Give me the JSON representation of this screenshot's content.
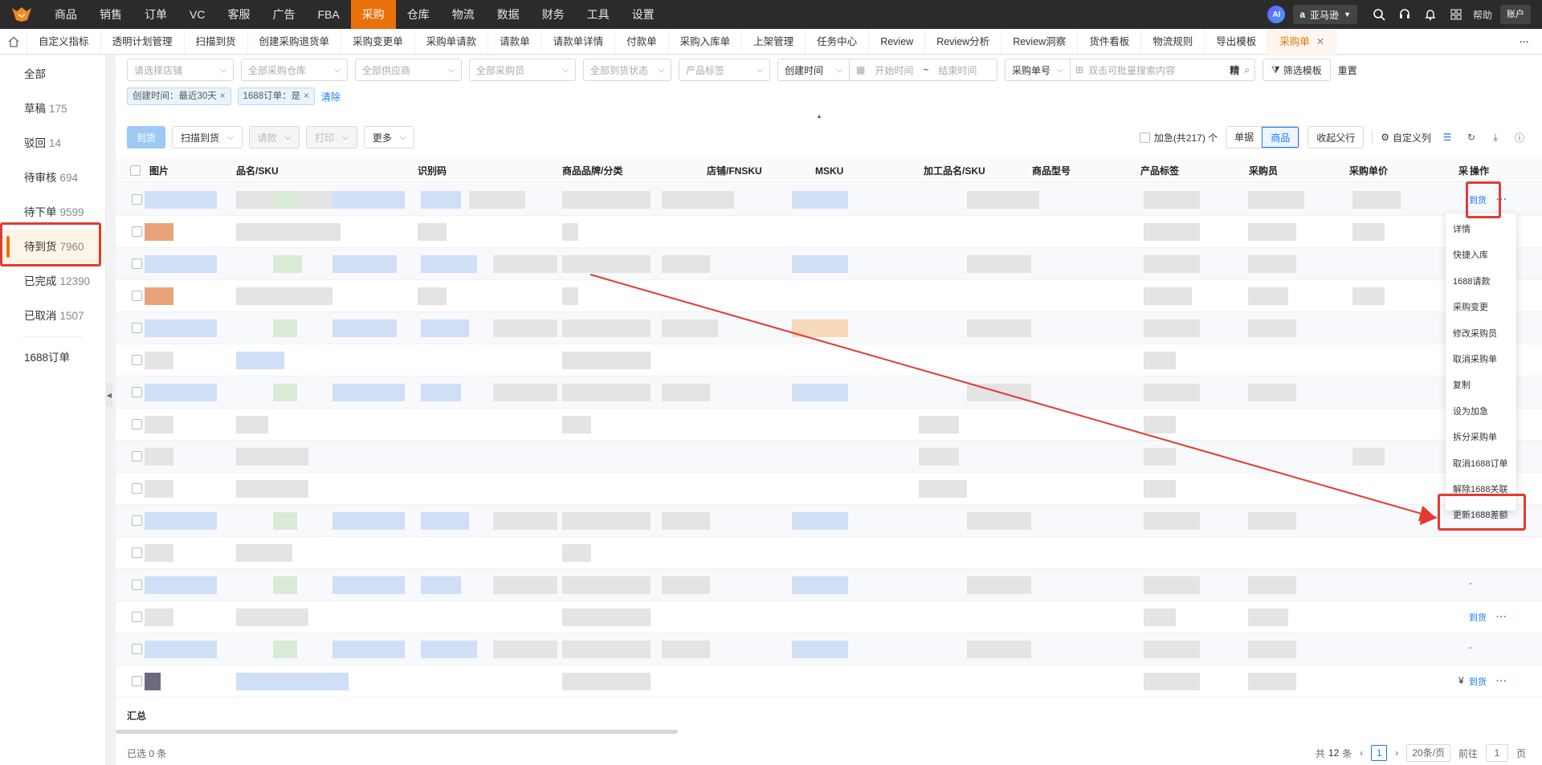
{
  "topnav": {
    "items": [
      "商品",
      "销售",
      "订单",
      "VC",
      "客服",
      "广告",
      "FBA",
      "采购",
      "仓库",
      "物流",
      "数据",
      "财务",
      "工具",
      "设置"
    ],
    "active_index": 7,
    "ai_label": "AI",
    "site": "亚马逊",
    "help": "帮助",
    "account": "账户"
  },
  "tabs": [
    "自定义指标",
    "透明计划管理",
    "扫描到货",
    "创建采购退货单",
    "采购变更单",
    "采购单请款",
    "请款单",
    "请款单详情",
    "付款单",
    "采购入库单",
    "上架管理",
    "任务中心",
    "Review",
    "Review分析",
    "Review洞察",
    "货件看板",
    "物流规则",
    "导出模板",
    "采购单"
  ],
  "tab_more": "···",
  "sidebar": [
    {
      "label": "全部",
      "count": ""
    },
    {
      "label": "草稿",
      "count": "175"
    },
    {
      "label": "驳回",
      "count": "14"
    },
    {
      "label": "待审核",
      "count": "694"
    },
    {
      "label": "待下单",
      "count": "9599"
    },
    {
      "label": "待到货",
      "count": "7960"
    },
    {
      "label": "已完成",
      "count": "12390"
    },
    {
      "label": "已取消",
      "count": "1507"
    },
    {
      "label": "1688订单",
      "count": ""
    }
  ],
  "filters": {
    "shop": "请选择店铺",
    "warehouse": "全部采购仓库",
    "supplier": "全部供应商",
    "buyer": "全部采购员",
    "arrival": "全部到货状态",
    "tag": "产品标签",
    "time_type": "创建时间",
    "start": "开始时间",
    "tilde": "~",
    "end": "结束时间",
    "no_type": "采购单号",
    "search_placeholder": "双击可批量搜索内容",
    "precise": "精",
    "template": "筛选模板",
    "reset": "重置"
  },
  "chips": [
    "创建时间：最近30天",
    "1688订单：是"
  ],
  "clear": "清除",
  "toolbar": {
    "arrive": "到货",
    "scan": "扫描到货",
    "pay_req": "请款",
    "print": "打印",
    "more": "更多",
    "urgent": "加急(共217) 个",
    "view_order": "单据",
    "view_goods": "商品",
    "collapse_parent": "收起父行",
    "custom_cols": "自定义列"
  },
  "columns": [
    "图片",
    "品名/SKU",
    "识别码",
    "商品品牌/分类",
    "店铺/FNSKU",
    "MSKU",
    "加工品名/SKU",
    "商品型号",
    "产品标签",
    "采购员",
    "采购单价",
    "采",
    "操作"
  ],
  "row_ops": [
    {
      "arrive": "到货",
      "more": "···"
    },
    {
      "arrive": "",
      "more": ""
    },
    {
      "arrive": "",
      "more": ""
    },
    {
      "arrive": "",
      "more": ""
    },
    {
      "arrive": "",
      "more": ""
    },
    {
      "arrive": "",
      "more": ""
    },
    {
      "arrive": "",
      "more": ""
    },
    {
      "arrive": "",
      "more": ""
    },
    {
      "arrive": "",
      "more": ""
    },
    {
      "arrive": "",
      "more": ""
    },
    {
      "arrive": "",
      "more": ""
    },
    {
      "arrive": "",
      "more": ""
    },
    {
      "arrive": "-",
      "more": ""
    },
    {
      "arrive": "到货",
      "more": "···"
    },
    {
      "arrive": "-",
      "more": ""
    },
    {
      "arrive": "到货",
      "more": "···"
    }
  ],
  "row_last_cell": "¥",
  "menu": [
    "详情",
    "快捷入库",
    "1688请款",
    "采购变更",
    "修改采购员",
    "取消采购单",
    "复制",
    "设为加急",
    "拆分采购单",
    "取消1688订单",
    "解除1688关联",
    "更新1688差额"
  ],
  "summary": "汇总",
  "footer": {
    "selected": "已选 0 条",
    "total_pre": "共",
    "total": "12",
    "total_post": "条",
    "page": "1",
    "page_size": "20条/页",
    "goto": "前往",
    "goto_val": "1",
    "page_word": "页"
  },
  "colors": {
    "accent": "#e8710a",
    "highlight": "#e23b34",
    "link": "#1677ff"
  }
}
